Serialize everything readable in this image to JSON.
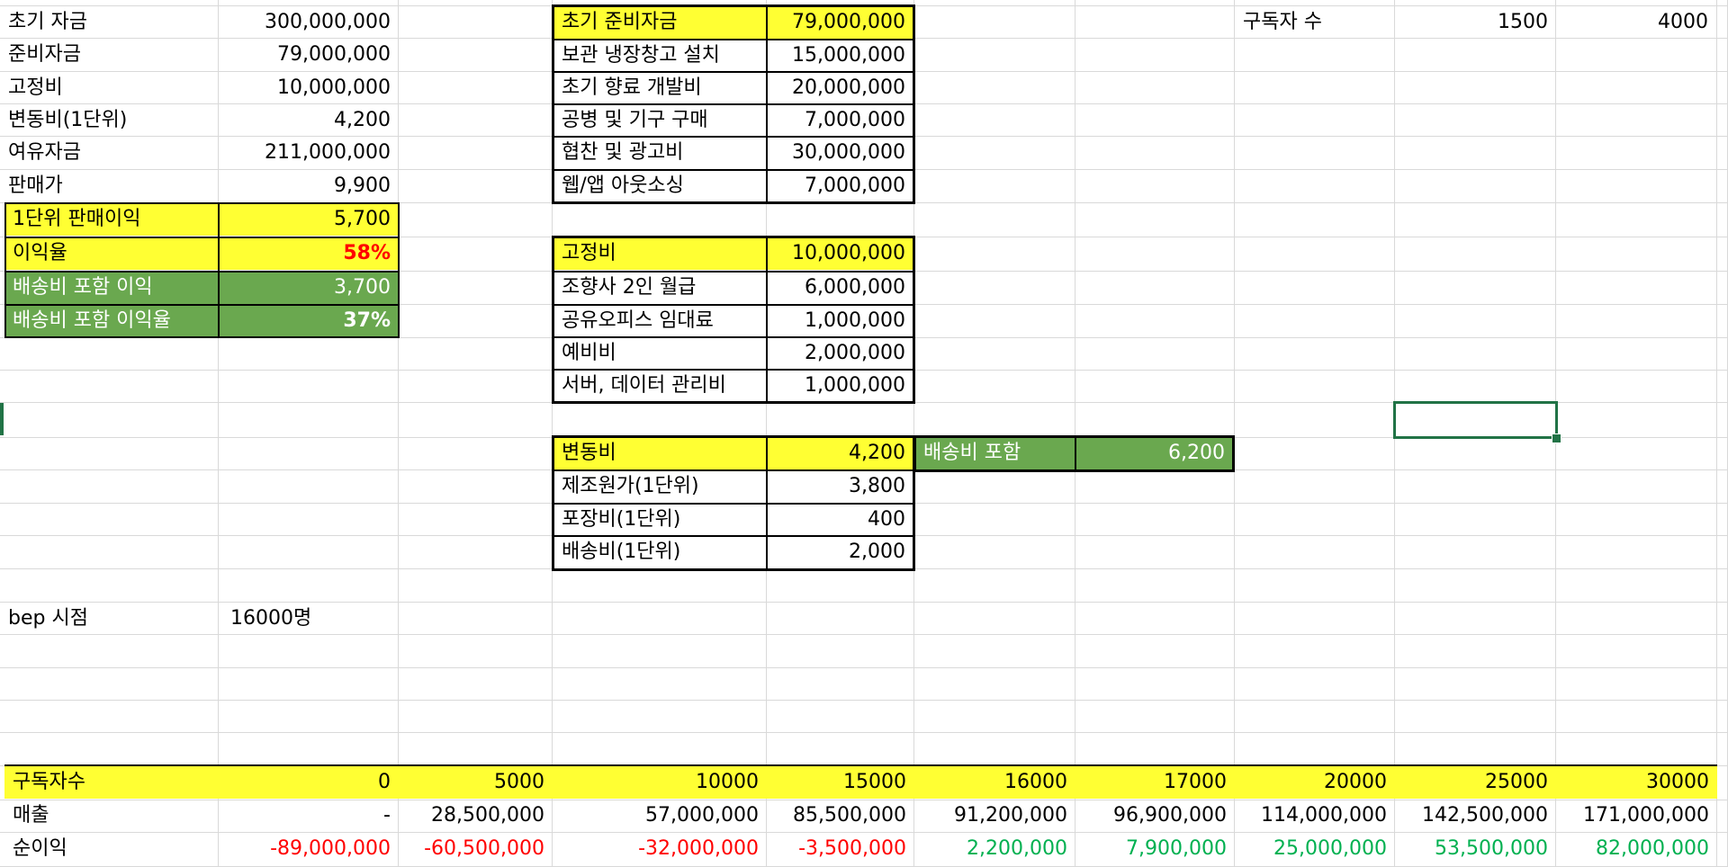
{
  "colors": {
    "highlight_yellow": "#ffff33",
    "highlight_green": "#6aa84f",
    "negative": "#ff0000",
    "positive": "#00b050",
    "selection": "#217346"
  },
  "summary": [
    {
      "label": "초기 자금",
      "value": "300,000,000"
    },
    {
      "label": "준비자금",
      "value": "79,000,000"
    },
    {
      "label": "고정비",
      "value": "10,000,000"
    },
    {
      "label": "변동비(1단위)",
      "value": "4,200"
    },
    {
      "label": "여유자금",
      "value": "211,000,000"
    },
    {
      "label": "판매가",
      "value": "9,900"
    },
    {
      "label": "1단위 판매이익",
      "value": "5,700"
    },
    {
      "label": "이익율",
      "value": "58%"
    },
    {
      "label": "배송비 포함 이익",
      "value": "3,700"
    },
    {
      "label": "배송비 포함 이익율",
      "value": "37%"
    }
  ],
  "bep": {
    "label": "bep 시점",
    "value": "16000명"
  },
  "prep_table": {
    "header": {
      "label": "초기 준비자금",
      "value": "79,000,000"
    },
    "rows": [
      {
        "label": "보관 냉장창고 설치",
        "value": "15,000,000"
      },
      {
        "label": "초기 향료 개발비",
        "value": "20,000,000"
      },
      {
        "label": "공병 및 기구 구매",
        "value": "7,000,000"
      },
      {
        "label": "협찬 및 광고비",
        "value": "30,000,000"
      },
      {
        "label": "웹/앱 아웃소싱",
        "value": "7,000,000"
      }
    ]
  },
  "fixed_table": {
    "header": {
      "label": "고정비",
      "value": "10,000,000"
    },
    "rows": [
      {
        "label": "조향사 2인 월급",
        "value": "6,000,000"
      },
      {
        "label": "공유오피스 임대료",
        "value": "1,000,000"
      },
      {
        "label": "예비비",
        "value": "2,000,000"
      },
      {
        "label": "서버, 데이터 관리비",
        "value": "1,000,000"
      }
    ]
  },
  "variable_table": {
    "header": {
      "label": "변동비",
      "value": "4,200"
    },
    "rows": [
      {
        "label": "제조원가(1단위)",
        "value": "3,800"
      },
      {
        "label": "포장비(1단위)",
        "value": "400"
      },
      {
        "label": "배송비(1단위)",
        "value": "2,000"
      }
    ],
    "shipping_included": {
      "label": "배송비 포함",
      "value": "6,200"
    }
  },
  "subscribers_top": {
    "label": "구독자 수",
    "values": [
      "1500",
      "4000"
    ]
  },
  "projection": {
    "row_labels": [
      "구독자수",
      "매출",
      "순이익"
    ],
    "subscribers": [
      "0",
      "5000",
      "10000",
      "15000",
      "16000",
      "17000",
      "20000",
      "25000",
      "30000"
    ],
    "revenue": [
      "-",
      "28,500,000",
      "57,000,000",
      "85,500,000",
      "91,200,000",
      "96,900,000",
      "114,000,000",
      "142,500,000",
      "171,000,000"
    ],
    "net_profit": [
      "-89,000,000",
      "-60,500,000",
      "-32,000,000",
      "-3,500,000",
      "2,200,000",
      "7,900,000",
      "25,000,000",
      "53,500,000",
      "82,000,000"
    ]
  }
}
